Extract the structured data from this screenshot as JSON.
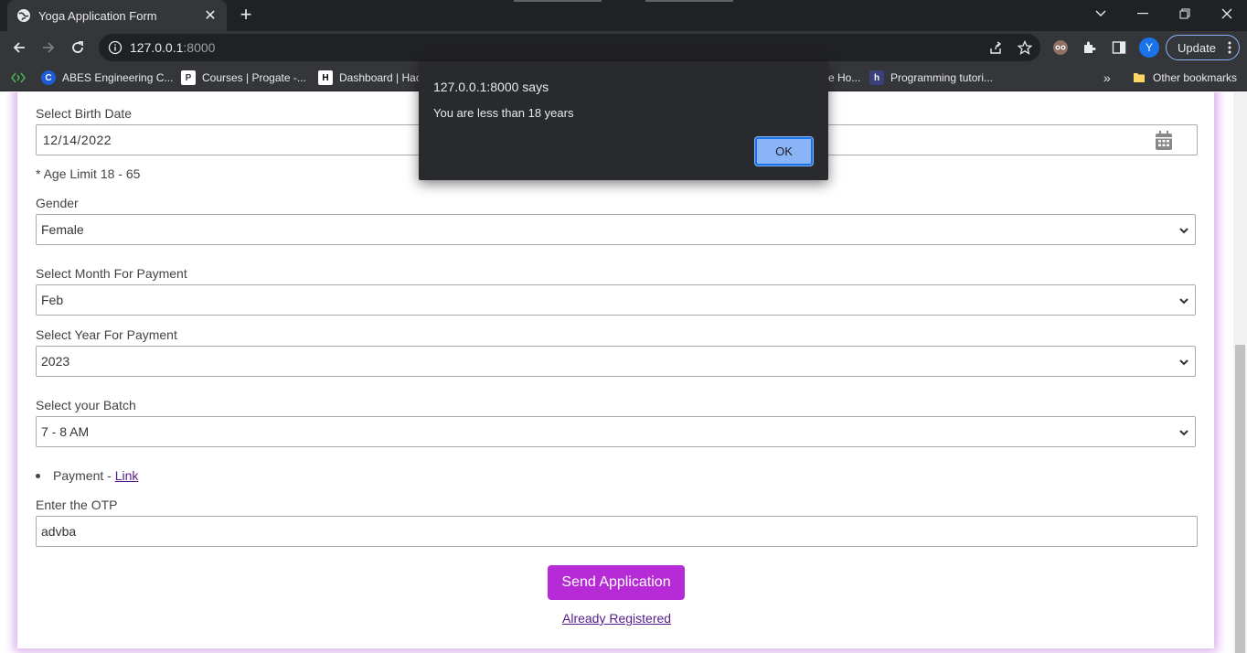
{
  "browser": {
    "tab_title": "Yoga Application Form",
    "url_host": "127.0.0.1",
    "url_port": ":8000",
    "profile_initial": "Y",
    "update_label": "Update"
  },
  "bookmarks": {
    "items": [
      {
        "label": "",
        "icon": "code-icon"
      },
      {
        "label": "ABES Engineering C...",
        "icon": "C"
      },
      {
        "label": "Courses | Progate -...",
        "icon": "P"
      },
      {
        "label": "Dashboard | Hac",
        "icon": "H"
      },
      {
        "label": "e Ho...",
        "icon": ""
      },
      {
        "label": "Programming tutori...",
        "icon": "h"
      }
    ],
    "overflow": "»",
    "other_label": "Other bookmarks"
  },
  "form": {
    "birth_date_label": "Select Birth Date",
    "birth_date_value": "12/14/2022",
    "age_limit_note": "* Age Limit 18 - 65",
    "gender_label": "Gender",
    "gender_value": "Female",
    "month_label": "Select Month For Payment",
    "month_value": "Feb",
    "year_label": "Select Year For Payment",
    "year_value": "2023",
    "batch_label": "Select your Batch",
    "batch_value": "7 - 8 AM",
    "payment_prefix": "Payment - ",
    "payment_link": "Link",
    "otp_label": "Enter the OTP",
    "otp_value": "advba",
    "submit_label": "Send Application",
    "registered_link": "Already Registered"
  },
  "dialog": {
    "title": "127.0.0.1:8000 says",
    "message": "You are less than 18 years",
    "ok_label": "OK"
  },
  "colors": {
    "accent": "#b62bd6",
    "chrome_dark": "#202124",
    "chrome_toolbar": "#35363a"
  }
}
